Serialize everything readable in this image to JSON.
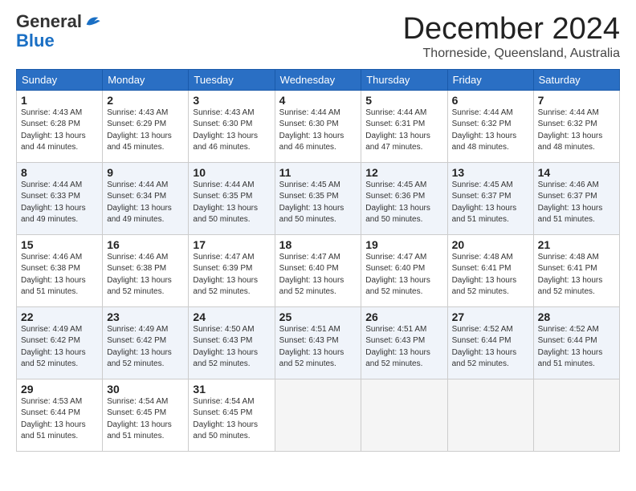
{
  "logo": {
    "general": "General",
    "blue": "Blue"
  },
  "title": "December 2024",
  "location": "Thorneside, Queensland, Australia",
  "days_of_week": [
    "Sunday",
    "Monday",
    "Tuesday",
    "Wednesday",
    "Thursday",
    "Friday",
    "Saturday"
  ],
  "weeks": [
    [
      {
        "day": 1,
        "sunrise": "4:43 AM",
        "sunset": "6:28 PM",
        "daylight": "13 hours and 44 minutes."
      },
      {
        "day": 2,
        "sunrise": "4:43 AM",
        "sunset": "6:29 PM",
        "daylight": "13 hours and 45 minutes."
      },
      {
        "day": 3,
        "sunrise": "4:43 AM",
        "sunset": "6:30 PM",
        "daylight": "13 hours and 46 minutes."
      },
      {
        "day": 4,
        "sunrise": "4:44 AM",
        "sunset": "6:30 PM",
        "daylight": "13 hours and 46 minutes."
      },
      {
        "day": 5,
        "sunrise": "4:44 AM",
        "sunset": "6:31 PM",
        "daylight": "13 hours and 47 minutes."
      },
      {
        "day": 6,
        "sunrise": "4:44 AM",
        "sunset": "6:32 PM",
        "daylight": "13 hours and 48 minutes."
      },
      {
        "day": 7,
        "sunrise": "4:44 AM",
        "sunset": "6:32 PM",
        "daylight": "13 hours and 48 minutes."
      }
    ],
    [
      {
        "day": 8,
        "sunrise": "4:44 AM",
        "sunset": "6:33 PM",
        "daylight": "13 hours and 49 minutes."
      },
      {
        "day": 9,
        "sunrise": "4:44 AM",
        "sunset": "6:34 PM",
        "daylight": "13 hours and 49 minutes."
      },
      {
        "day": 10,
        "sunrise": "4:44 AM",
        "sunset": "6:35 PM",
        "daylight": "13 hours and 50 minutes."
      },
      {
        "day": 11,
        "sunrise": "4:45 AM",
        "sunset": "6:35 PM",
        "daylight": "13 hours and 50 minutes."
      },
      {
        "day": 12,
        "sunrise": "4:45 AM",
        "sunset": "6:36 PM",
        "daylight": "13 hours and 50 minutes."
      },
      {
        "day": 13,
        "sunrise": "4:45 AM",
        "sunset": "6:37 PM",
        "daylight": "13 hours and 51 minutes."
      },
      {
        "day": 14,
        "sunrise": "4:46 AM",
        "sunset": "6:37 PM",
        "daylight": "13 hours and 51 minutes."
      }
    ],
    [
      {
        "day": 15,
        "sunrise": "4:46 AM",
        "sunset": "6:38 PM",
        "daylight": "13 hours and 51 minutes."
      },
      {
        "day": 16,
        "sunrise": "4:46 AM",
        "sunset": "6:38 PM",
        "daylight": "13 hours and 52 minutes."
      },
      {
        "day": 17,
        "sunrise": "4:47 AM",
        "sunset": "6:39 PM",
        "daylight": "13 hours and 52 minutes."
      },
      {
        "day": 18,
        "sunrise": "4:47 AM",
        "sunset": "6:40 PM",
        "daylight": "13 hours and 52 minutes."
      },
      {
        "day": 19,
        "sunrise": "4:47 AM",
        "sunset": "6:40 PM",
        "daylight": "13 hours and 52 minutes."
      },
      {
        "day": 20,
        "sunrise": "4:48 AM",
        "sunset": "6:41 PM",
        "daylight": "13 hours and 52 minutes."
      },
      {
        "day": 21,
        "sunrise": "4:48 AM",
        "sunset": "6:41 PM",
        "daylight": "13 hours and 52 minutes."
      }
    ],
    [
      {
        "day": 22,
        "sunrise": "4:49 AM",
        "sunset": "6:42 PM",
        "daylight": "13 hours and 52 minutes."
      },
      {
        "day": 23,
        "sunrise": "4:49 AM",
        "sunset": "6:42 PM",
        "daylight": "13 hours and 52 minutes."
      },
      {
        "day": 24,
        "sunrise": "4:50 AM",
        "sunset": "6:43 PM",
        "daylight": "13 hours and 52 minutes."
      },
      {
        "day": 25,
        "sunrise": "4:51 AM",
        "sunset": "6:43 PM",
        "daylight": "13 hours and 52 minutes."
      },
      {
        "day": 26,
        "sunrise": "4:51 AM",
        "sunset": "6:43 PM",
        "daylight": "13 hours and 52 minutes."
      },
      {
        "day": 27,
        "sunrise": "4:52 AM",
        "sunset": "6:44 PM",
        "daylight": "13 hours and 52 minutes."
      },
      {
        "day": 28,
        "sunrise": "4:52 AM",
        "sunset": "6:44 PM",
        "daylight": "13 hours and 51 minutes."
      }
    ],
    [
      {
        "day": 29,
        "sunrise": "4:53 AM",
        "sunset": "6:44 PM",
        "daylight": "13 hours and 51 minutes."
      },
      {
        "day": 30,
        "sunrise": "4:54 AM",
        "sunset": "6:45 PM",
        "daylight": "13 hours and 51 minutes."
      },
      {
        "day": 31,
        "sunrise": "4:54 AM",
        "sunset": "6:45 PM",
        "daylight": "13 hours and 50 minutes."
      },
      null,
      null,
      null,
      null
    ]
  ]
}
